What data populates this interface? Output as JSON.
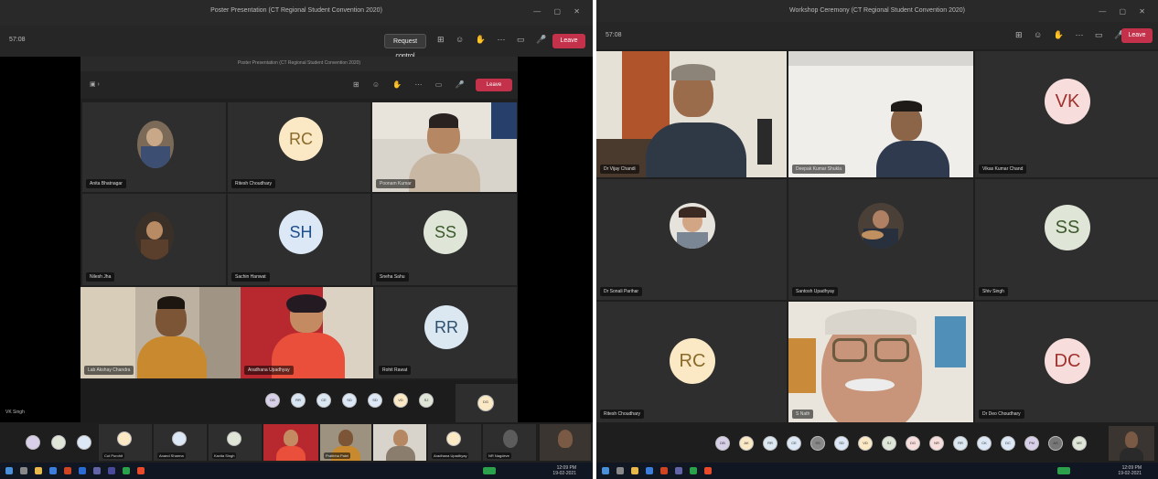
{
  "left": {
    "window_title": "Poster Presentation (CT Regional Student Convention 2020)",
    "inner_title": "Poster Presentation (CT Regional Student Convention 2020)",
    "timer": "57:08",
    "request_control_label": "Request control",
    "leave_label": "Leave",
    "inner_leave_label": "Leave",
    "grid_avatars": [
      {
        "initials": "RC",
        "name": "Ritesh Choudhary",
        "bg": "#fbe8c4",
        "fg": "#8a6a2a"
      },
      {
        "initials": "SH",
        "name": "Sachin Hanwat",
        "bg": "#dce8f6",
        "fg": "#1f4e8c"
      },
      {
        "initials": "SS",
        "name": "Sneha Sahu",
        "bg": "#dfe6d8",
        "fg": "#3c5a2c"
      },
      {
        "initials": "RR",
        "name": "Rohit Rawat",
        "bg": "#dbe7f1",
        "fg": "#2f4f6e"
      }
    ],
    "grid_photos": [
      {
        "name": "Anita Bhatnagar"
      },
      {
        "name": "Nilesh Jha"
      }
    ],
    "grid_videos": [
      {
        "name": "Poonam Kumar"
      },
      {
        "name": "Lab Akshay Chandra"
      },
      {
        "name": "Aradhana Upadhyay"
      }
    ],
    "sharer_label": "VK Singh",
    "inner_dots": [
      "DB",
      "RR",
      "CE",
      "SD",
      "SD",
      "VD",
      "SJ",
      "DG"
    ],
    "bottom_names": [
      "Cut Purohit",
      "Anand Sharma",
      "Kavita Singh",
      "Pratibha Patel",
      "Aradhana Upadhyay",
      "NR Nagdeve"
    ]
  },
  "right": {
    "window_title": "Workshop Ceremony (CT Regional Student Convention 2020)",
    "timer": "57:08",
    "leave_label": "Leave",
    "grid_avatars": [
      {
        "initials": "VK",
        "name": "Vikas Kumar Chand",
        "bg": "#f7dedd",
        "fg": "#a0312c"
      },
      {
        "initials": "SS",
        "name": "Shiv Singh",
        "bg": "#dfe6d8",
        "fg": "#3c5a2c"
      },
      {
        "initials": "RC",
        "name": "Ritesh Choudhary",
        "bg": "#fbe8c4",
        "fg": "#8a6a2a"
      },
      {
        "initials": "DC",
        "name": "Dr Deo Choudhary",
        "bg": "#f7dedd",
        "fg": "#a0312c"
      }
    ],
    "grid_videos": [
      {
        "name": "Dr Vijay Chandi"
      },
      {
        "name": "Deepak Kumar Shukla"
      },
      {
        "name": "S Nath"
      }
    ],
    "grid_photos": [
      {
        "name": "Dr Sonali Parihar"
      },
      {
        "name": "Santosh Upadhyay"
      }
    ],
    "bottom_dots": [
      "DB",
      "AK",
      "RR",
      "CE",
      "SS",
      "SD",
      "VD",
      "SJ",
      "DG",
      "NR",
      "RR",
      "CK",
      "DC",
      "PM",
      "AS",
      "ME"
    ]
  },
  "taskbar": {
    "clock_left": "12:09 PM",
    "date_left": "19-02-2021",
    "clock_right": "12:09 PM",
    "date_right": "19-02-2021"
  }
}
